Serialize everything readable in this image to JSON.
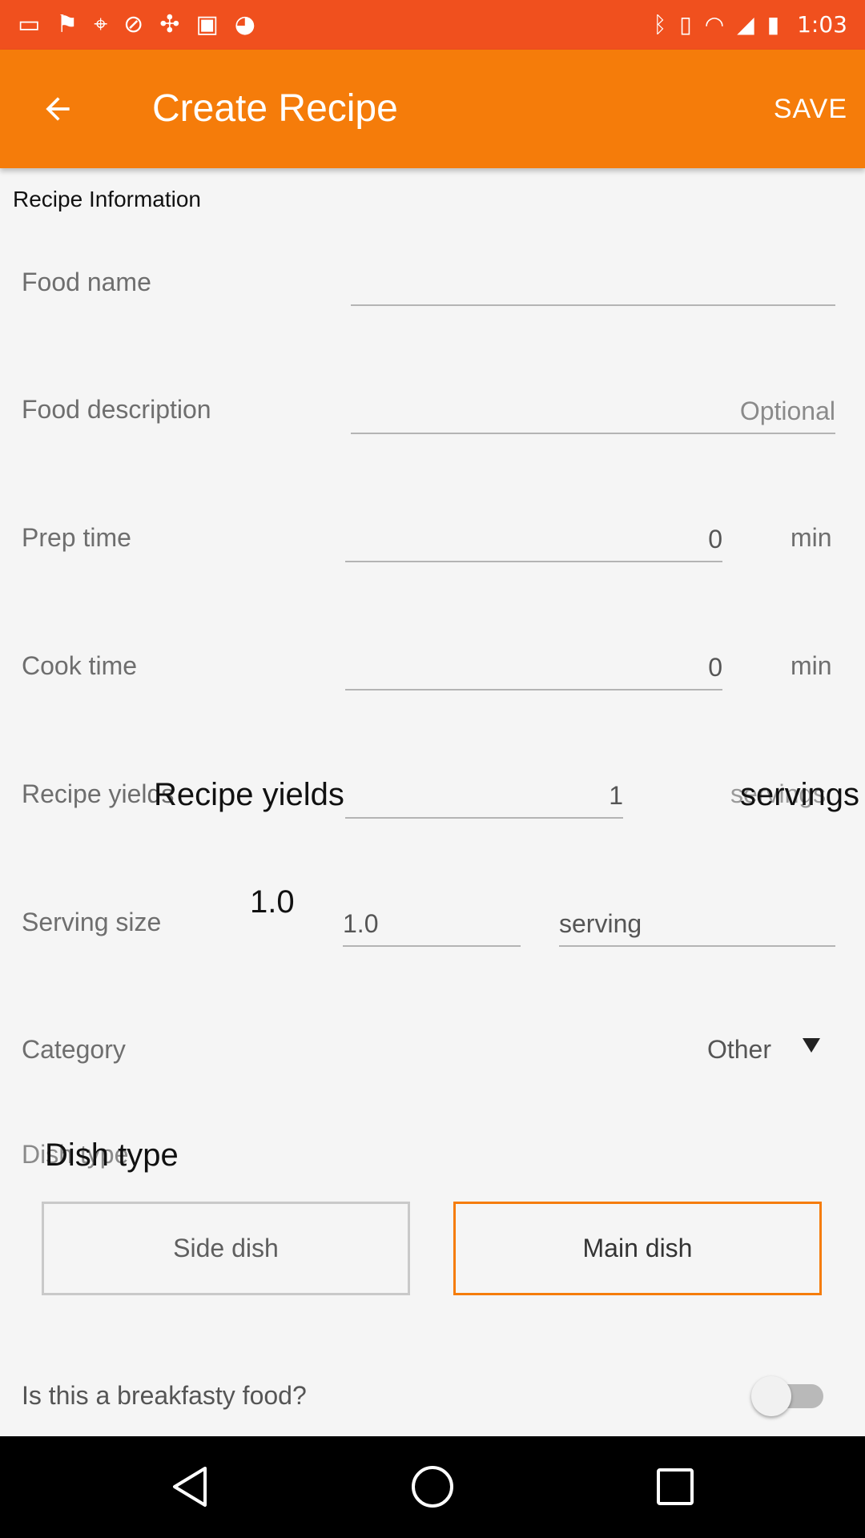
{
  "status_bar": {
    "time": "1:03",
    "left_icons": [
      "message-icon",
      "flag-icon",
      "fake-gps-icon",
      "block-icon",
      "satellite-icon",
      "lock-icon",
      "android-icon"
    ],
    "right_icons": [
      "bluetooth-icon",
      "vibrate-icon",
      "wifi-icon",
      "signal-icon",
      "battery-icon"
    ]
  },
  "app_bar": {
    "title": "Create Recipe",
    "save_label": "SAVE",
    "back_icon": "arrow-left-icon"
  },
  "section": {
    "title": "Recipe Information"
  },
  "form": {
    "food_name": {
      "label": "Food name",
      "value": ""
    },
    "food_description": {
      "label": "Food description",
      "placeholder": "Optional"
    },
    "prep_time": {
      "label": "Prep time",
      "value": "0",
      "unit": "min"
    },
    "cook_time": {
      "label": "Cook time",
      "value": "0",
      "unit": "min"
    },
    "recipe_yields": {
      "label": "Recipe yields",
      "overlay_label": "Recipe yields",
      "value": "1",
      "unit": "servings",
      "overlay_unit": "servings"
    },
    "serving_size": {
      "label": "Serving size",
      "overlay_value": "1.0",
      "value": "1.0",
      "unit_value": "serving"
    },
    "category": {
      "label": "Category",
      "value": "Other"
    },
    "dish_type": {
      "label": "Dish type",
      "overlay_label": "Dish type",
      "options": [
        "Side dish",
        "Main dish"
      ],
      "selected": "Main dish"
    },
    "breakfast": {
      "label": "Is this a breakfasty food?",
      "checked": false
    }
  },
  "colors": {
    "accent": "#f57c0a",
    "status_bar": "#f0501e",
    "background": "#f5f5f5"
  },
  "nav_bar": {
    "icons": [
      "back-triangle-icon",
      "home-circle-icon",
      "recents-square-icon"
    ]
  }
}
